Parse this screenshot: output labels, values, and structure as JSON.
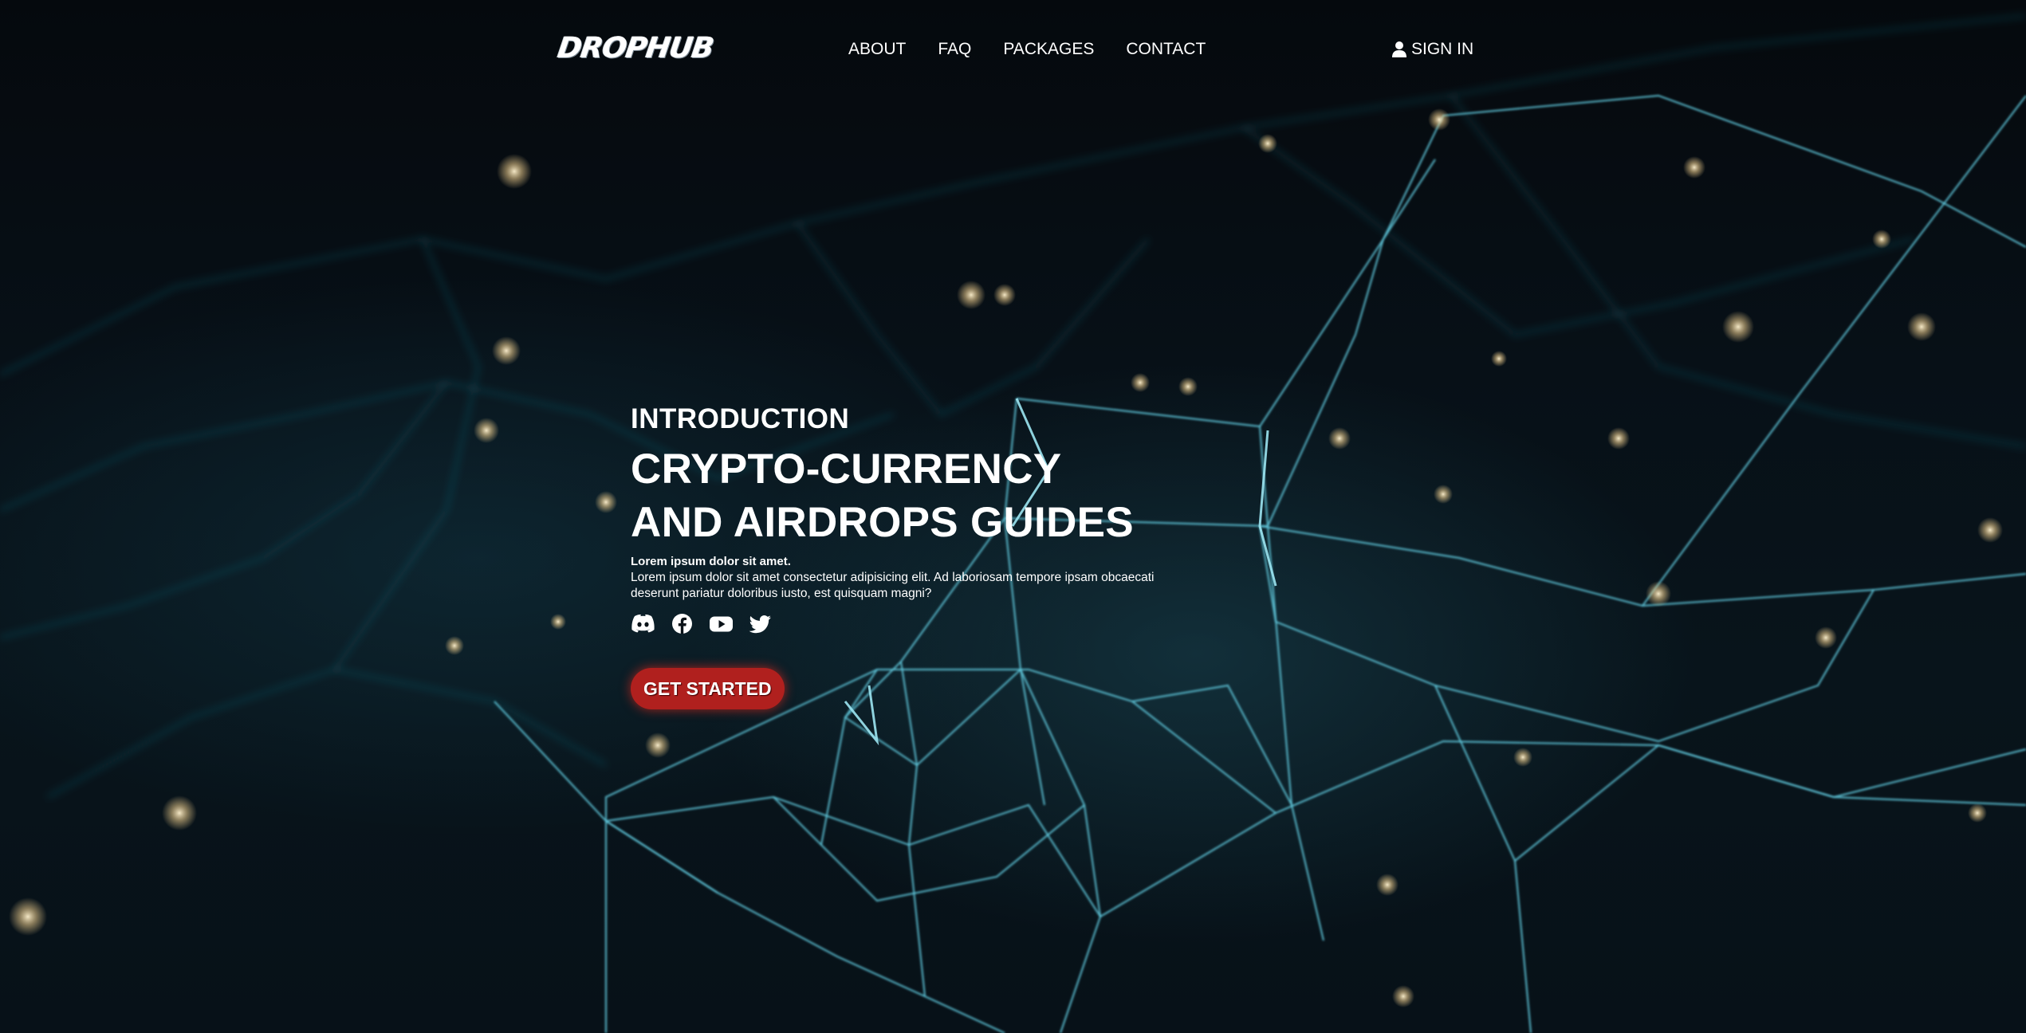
{
  "brand": {
    "logo_text": "DROPHUB"
  },
  "nav": {
    "items": [
      {
        "label": "ABOUT"
      },
      {
        "label": "FAQ"
      },
      {
        "label": "PACKAGES"
      },
      {
        "label": "CONTACT"
      }
    ],
    "signin_label": "SIGN IN"
  },
  "hero": {
    "eyebrow": "INTRODUCTION",
    "title_line1": "CRYPTO-CURRENCY",
    "title_line2": "AND AIRDROPS GUIDES",
    "lead": "Lorem ipsum dolor sit amet.",
    "description": "Lorem ipsum dolor sit amet consectetur adipisicing elit. Ad laboriosam tempore ipsam obcaecati deserunt pariatur doloribus iusto, est quisquam magni?",
    "socials": [
      {
        "icon": "discord-icon"
      },
      {
        "icon": "facebook-icon"
      },
      {
        "icon": "youtube-icon"
      },
      {
        "icon": "twitter-icon"
      }
    ],
    "cta_label": "GET STARTED"
  },
  "colors": {
    "background": "#060b10",
    "network_line": "#3fb3c9",
    "particle": "#f3d9a0",
    "cta": "#b0201e",
    "text": "#ffffff"
  }
}
